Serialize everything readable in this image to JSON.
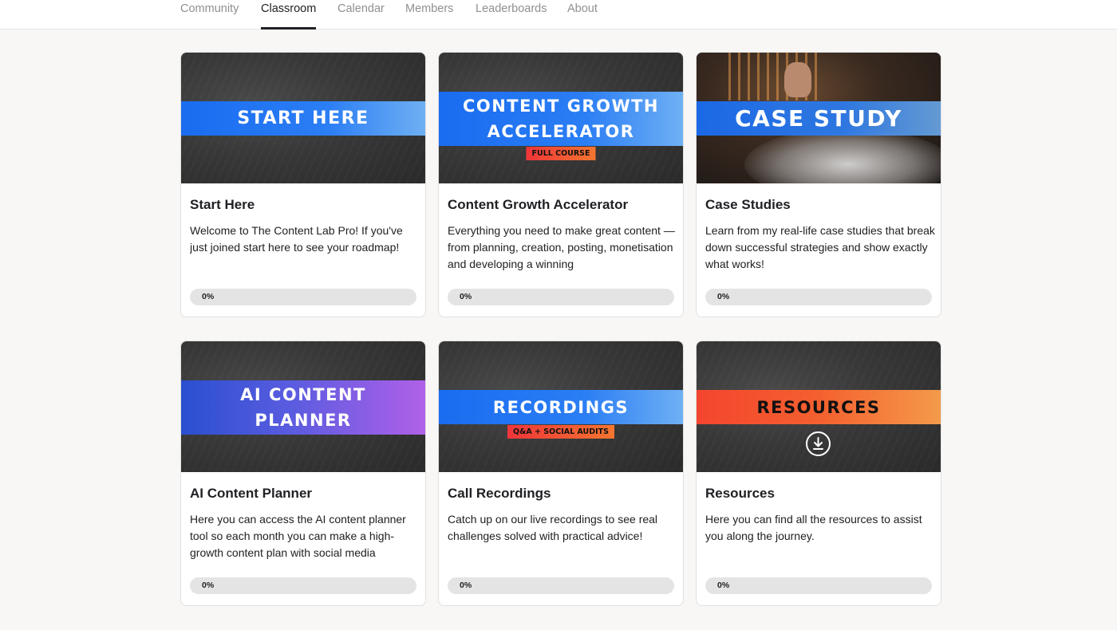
{
  "nav": {
    "tabs": [
      {
        "label": "Community",
        "active": false
      },
      {
        "label": "Classroom",
        "active": true
      },
      {
        "label": "Calendar",
        "active": false
      },
      {
        "label": "Members",
        "active": false
      },
      {
        "label": "Leaderboards",
        "active": false
      },
      {
        "label": "About",
        "active": false
      }
    ]
  },
  "courses": [
    {
      "thumb_lines": [
        "START HERE"
      ],
      "title": "Start Here",
      "description": "Welcome to The Content Lab Pro! If you've just joined start here to see your roadmap!",
      "progress": 0,
      "progress_label": "0%"
    },
    {
      "thumb_lines": [
        "CONTENT GROWTH",
        "ACCELERATOR"
      ],
      "thumb_badge": "FULL COURSE",
      "title": "Content Growth Accelerator",
      "description": "Everything you need to make great content — from planning, creation, posting, monetisation and developing a winning",
      "progress": 0,
      "progress_label": "0%"
    },
    {
      "thumb_lines": [
        "CASE STUDY"
      ],
      "title": "Case Studies",
      "description": "Learn from my real-life case studies that break down successful strategies and show exactly what works!",
      "progress": 0,
      "progress_label": "0%"
    },
    {
      "thumb_lines": [
        "AI CONTENT",
        "PLANNER"
      ],
      "title": "AI Content Planner",
      "description": "Here you can access the AI content planner tool so each month you can make a high-growth content plan with social media",
      "progress": 0,
      "progress_label": "0%"
    },
    {
      "thumb_lines": [
        "RECORDINGS"
      ],
      "thumb_badge": "Q&A + SOCIAL AUDITS",
      "title": "Call Recordings",
      "description": "Catch up on our live recordings to see real challenges solved with practical advice!",
      "progress": 0,
      "progress_label": "0%"
    },
    {
      "thumb_lines": [
        "RESOURCES"
      ],
      "thumb_icon": "download-icon",
      "title": "Resources",
      "description": "Here you can find all the resources to assist you along the journey.",
      "progress": 0,
      "progress_label": "0%"
    }
  ],
  "colors": {
    "blue_band": "#1a6cf0",
    "purple_band": "#b060e8",
    "orange_band": "#f4452f",
    "active_tab": "#202124",
    "inactive_tab": "#909090"
  }
}
